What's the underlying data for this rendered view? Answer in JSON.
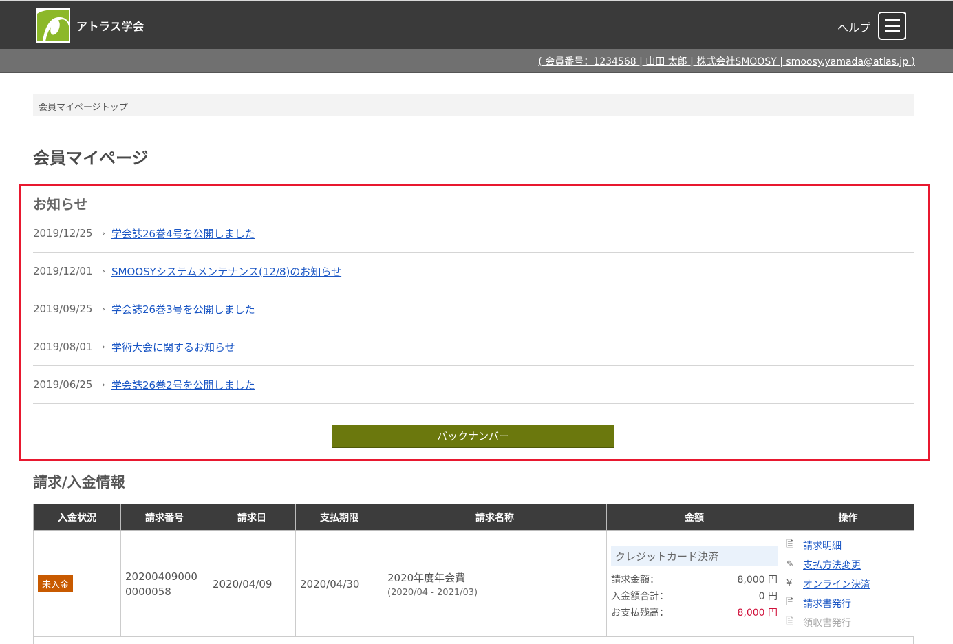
{
  "header": {
    "org_name": "アトラス学会",
    "help_label": "ヘルプ",
    "user_info": "( 会員番号：1234568 | 山田 太郎 | 株式会社SMOOSY | smoosy.yamada@atlas.jp )"
  },
  "breadcrumb": {
    "current": "会員マイページトップ"
  },
  "page": {
    "title": "会員マイページ"
  },
  "notices": {
    "heading": "お知らせ",
    "items": [
      {
        "date": "2019/12/25",
        "title": "学会誌26巻4号を公開しました"
      },
      {
        "date": "2019/12/01",
        "title": "SMOOSYシステムメンテナンス(12/8)のお知らせ"
      },
      {
        "date": "2019/09/25",
        "title": "学会誌26巻3号を公開しました"
      },
      {
        "date": "2019/08/01",
        "title": "学術大会に関するお知らせ"
      },
      {
        "date": "2019/06/25",
        "title": "学会誌26巻2号を公開しました"
      }
    ],
    "backnumber_label": "バックナンバー"
  },
  "billing": {
    "heading": "請求/入金情報",
    "columns": [
      "入金状況",
      "請求番号",
      "請求日",
      "支払期限",
      "請求名称",
      "金額",
      "操作"
    ],
    "rows": [
      {
        "status": "未入金",
        "invoice_number": "202004090000000058",
        "invoice_date": "2020/04/09",
        "due_date": "2020/04/30",
        "name": "2020年度年会費",
        "period": "(2020/04 - 2021/03)",
        "pay_method": "クレジットカード決済",
        "amount_label": "請求金額：",
        "amount_value": "8,000 円",
        "paid_label": "入金額合計：",
        "paid_value": "0 円",
        "balance_label": "お支払残高：",
        "balance_value": "8,000 円",
        "ops": {
          "detail": "請求明細",
          "change_method": "支払方法変更",
          "online_pay": "オンライン決済",
          "issue_invoice": "請求書発行",
          "issue_receipt": "領収書発行"
        }
      }
    ]
  },
  "colors": {
    "accent_red": "#e8182f",
    "button_olive": "#6b780d",
    "badge_orange": "#c85a00",
    "header_dark": "#3a3a3a"
  }
}
